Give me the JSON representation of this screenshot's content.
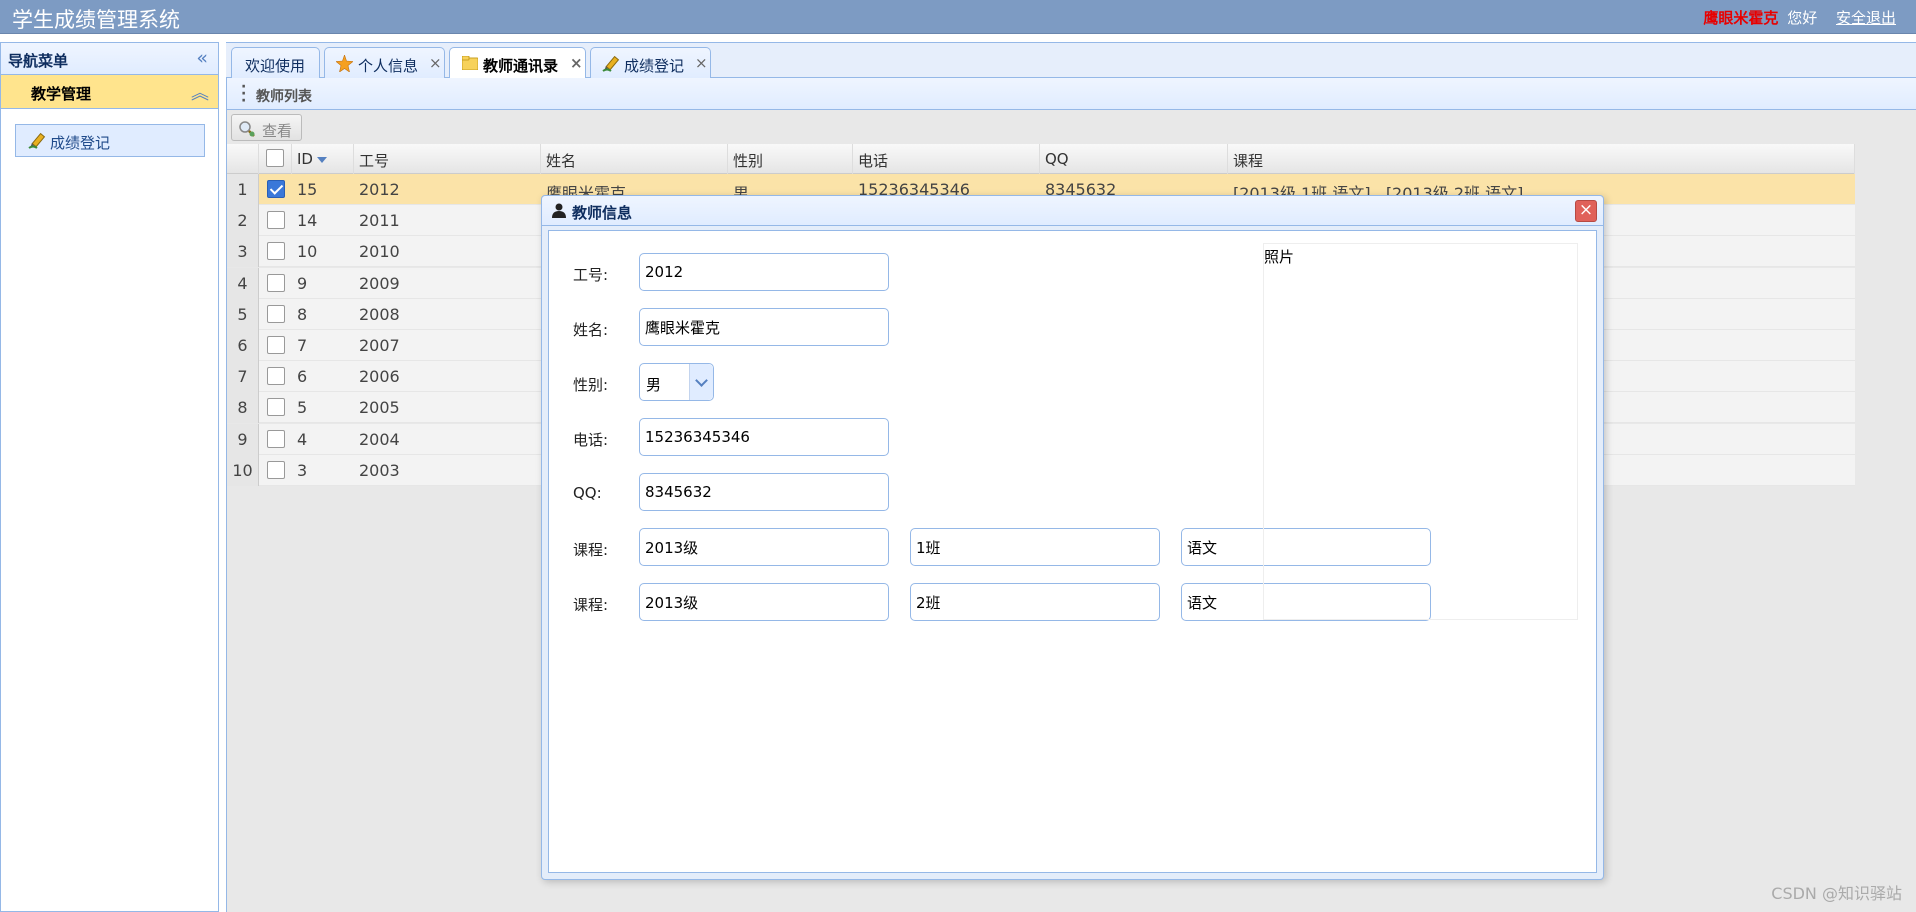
{
  "app": {
    "title": "学生成绩管理系统",
    "user_name": "鹰眼米霍克",
    "greeting": "您好",
    "logout_label": "安全退出"
  },
  "sidebar": {
    "title": "导航菜单",
    "section_title": "教学管理",
    "items": [
      {
        "label": "成绩登记",
        "icon": "pencil-icon"
      }
    ]
  },
  "tabs": [
    {
      "label": "欢迎使用",
      "closable": false,
      "icon": ""
    },
    {
      "label": "个人信息",
      "closable": true,
      "icon": "star-icon"
    },
    {
      "label": "教师通讯录",
      "closable": true,
      "icon": "folder-icon",
      "active": true
    },
    {
      "label": "成绩登记",
      "closable": true,
      "icon": "pencil-icon"
    }
  ],
  "close_symbol": "×",
  "panel": {
    "title": "教师列表",
    "view_button": "查看"
  },
  "grid": {
    "columns": [
      "ID",
      "工号",
      "姓名",
      "性别",
      "电话",
      "QQ",
      "课程"
    ],
    "rows": [
      {
        "num": "1",
        "id": "15",
        "code": "2012",
        "name": "鹰眼米霍克",
        "gender": "男",
        "phone": "15236345346",
        "qq": "8345632",
        "course": "[2013级 1班 语文] , [2013级 2班 语文]",
        "checked": true
      },
      {
        "num": "2",
        "id": "14",
        "code": "2011"
      },
      {
        "num": "3",
        "id": "10",
        "code": "2010"
      },
      {
        "num": "4",
        "id": "9",
        "code": "2009"
      },
      {
        "num": "5",
        "id": "8",
        "code": "2008"
      },
      {
        "num": "6",
        "id": "7",
        "code": "2007"
      },
      {
        "num": "7",
        "id": "6",
        "code": "2006"
      },
      {
        "num": "8",
        "id": "5",
        "code": "2005"
      },
      {
        "num": "9",
        "id": "4",
        "code": "2004"
      },
      {
        "num": "10",
        "id": "3",
        "code": "2003"
      }
    ]
  },
  "dialog": {
    "title": "教师信息",
    "close_symbol": "×",
    "labels": {
      "code": "工号:",
      "name": "姓名:",
      "gender": "性别:",
      "phone": "电话:",
      "qq": "QQ:",
      "course": "课程:"
    },
    "values": {
      "code": "2012",
      "name": "鹰眼米霍克",
      "gender": "男",
      "phone": "15236345346",
      "qq": "8345632",
      "course1": {
        "grade": "2013级",
        "class": "1班",
        "subject": "语文"
      },
      "course2": {
        "grade": "2013级",
        "class": "2班",
        "subject": "语文"
      }
    },
    "photo_label": "照片"
  },
  "watermark": "CSDN @知识驿站"
}
